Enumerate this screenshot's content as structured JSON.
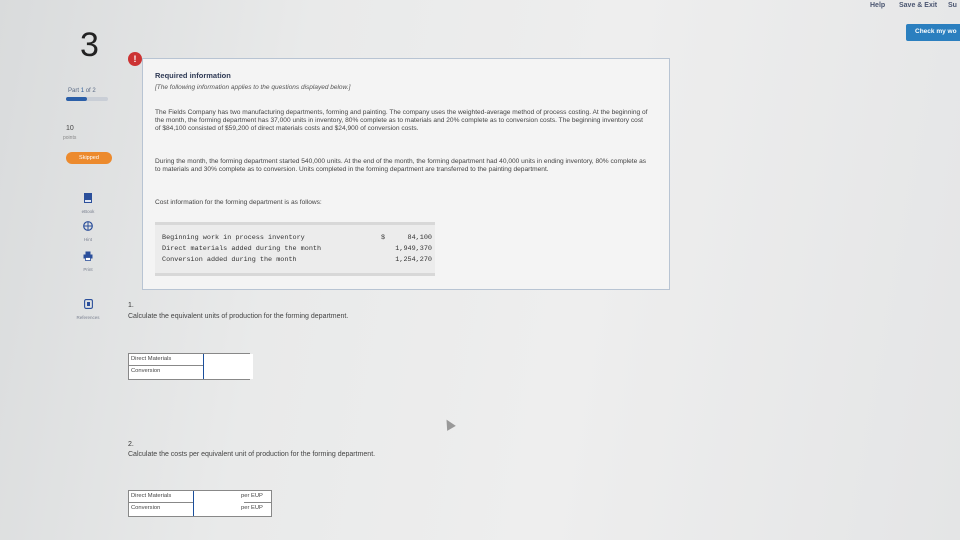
{
  "header": {
    "help_label": "Help",
    "save_exit_label": "Save & Exit",
    "submit_label": "Su",
    "check_label": "Check my wo"
  },
  "sidebar": {
    "question_number": "3",
    "part_prefix": "Part",
    "part_current": "1",
    "part_suffix": "of 2",
    "progress_fraction": 0.5,
    "points_value": "10",
    "points_label": "points",
    "skipped_label": "Skipped",
    "tools": [
      {
        "label": "eBook",
        "icon": "book-icon"
      },
      {
        "label": "Hint",
        "icon": "hint-icon"
      },
      {
        "label": "Print",
        "icon": "print-icon"
      },
      {
        "label": "References",
        "icon": "references-icon"
      }
    ]
  },
  "info": {
    "alert_glyph": "!",
    "title": "Required information",
    "note": "[The following information applies to the questions displayed below.]",
    "para1": "The Fields Company has two manufacturing departments, forming and painting. The company uses the weighted-average method of process costing. At the beginning of the month, the forming department has 37,000 units in inventory, 80% complete as to materials and 20% complete as to conversion costs. The beginning inventory cost of $84,100 consisted of $59,200 of direct materials costs and $24,900 of conversion costs.",
    "para2": "During the month, the forming department started 540,000 units. At the end of the month, the forming department had 40,000 units in ending inventory, 80% complete as to materials and 30% complete as to conversion. Units completed in the forming department are transferred to the painting department.",
    "para3": "Cost information for the forming department is as follows:",
    "cost_rows": [
      {
        "label": "Beginning work in process inventory",
        "currency": "$",
        "value": "84,100"
      },
      {
        "label": "Direct materials added during the month",
        "currency": "",
        "value": "1,949,370"
      },
      {
        "label": "Conversion added during the month",
        "currency": "",
        "value": "1,254,270"
      }
    ]
  },
  "q1": {
    "number": "1.",
    "text": "Calculate the equivalent units of production for the forming department.",
    "rows": [
      {
        "label": "Direct Materials",
        "value": ""
      },
      {
        "label": "Conversion",
        "value": ""
      }
    ]
  },
  "q2": {
    "number": "2.",
    "text": "Calculate the costs per equivalent unit of production for the forming department.",
    "rows": [
      {
        "label": "Direct Materials",
        "value": "",
        "unit": "per EUP"
      },
      {
        "label": "Conversion",
        "value": "",
        "unit": "per EUP"
      }
    ]
  }
}
